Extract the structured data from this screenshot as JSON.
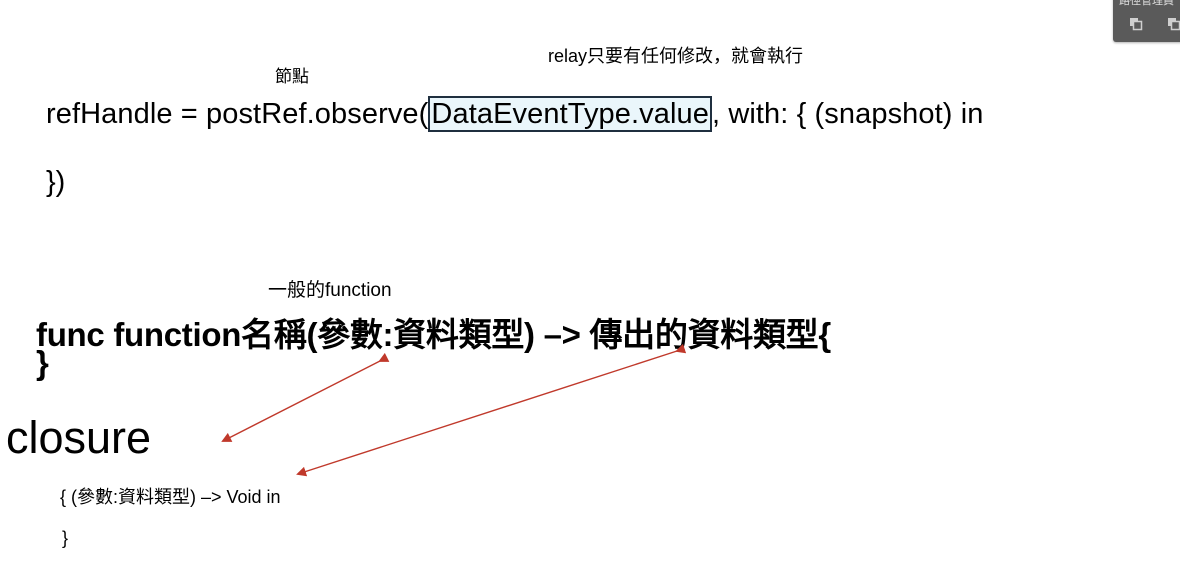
{
  "notes": {
    "relay": "relay只要有任何修改，就會執行",
    "node": "節點",
    "normal_function": "一般的function"
  },
  "observe_code": {
    "prefix": "refHandle = postRef.observe(",
    "highlighted": "DataEventType.value",
    "suffix": ", with: { (snapshot) in",
    "closing": "})"
  },
  "function_code": {
    "line": "func function名稱(參數:資料類型) –> 傳出的資料類型{",
    "closing": "}"
  },
  "closure": {
    "heading": "closure",
    "line": "{ (參數:資料類型) –> Void in",
    "closing": "}"
  },
  "panel": {
    "title": "路徑管理員",
    "icons": [
      "duplicate-icon",
      "duplicate-icon"
    ]
  },
  "colors": {
    "arrow": "#c0392b",
    "highlight_fill": "#eaf6fb",
    "highlight_border": "#1f2f3f",
    "panel_bg": "#5a5a5a"
  }
}
